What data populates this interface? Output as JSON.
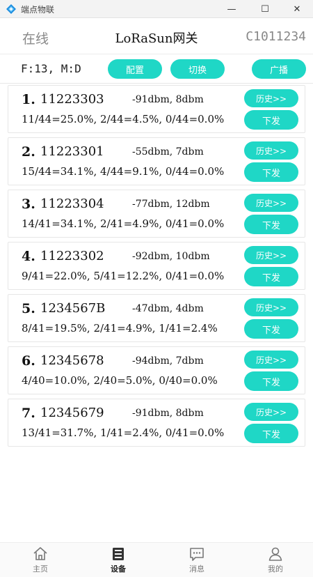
{
  "window": {
    "title": "端点物联",
    "minimize": "—",
    "maximize": "☐",
    "close": "✕"
  },
  "header": {
    "status": "在线",
    "title": "LoRaSun网关",
    "gateway_id": "C1011234"
  },
  "toolbar": {
    "freq_text": "F:13, M:D",
    "config_label": "配置",
    "switch_label": "切换",
    "broadcast_label": "广播"
  },
  "devices": [
    {
      "index": "1.",
      "id": "11223303",
      "signal": "-91dbm, 8dbm",
      "stats": "11/44=25.0%,  2/44=4.5%,  0/44=0.0%",
      "history_label": "历史>>",
      "send_label": "下发"
    },
    {
      "index": "2.",
      "id": "11223301",
      "signal": "-55dbm, 7dbm",
      "stats": "15/44=34.1%,  4/44=9.1%,  0/44=0.0%",
      "history_label": "历史>>",
      "send_label": "下发"
    },
    {
      "index": "3.",
      "id": "11223304",
      "signal": "-77dbm, 12dbm",
      "stats": "14/41=34.1%,  2/41=4.9%,  0/41=0.0%",
      "history_label": "历史>>",
      "send_label": "下发"
    },
    {
      "index": "4.",
      "id": "11223302",
      "signal": "-92dbm, 10dbm",
      "stats": "9/41=22.0%,  5/41=12.2%,  0/41=0.0%",
      "history_label": "历史>>",
      "send_label": "下发"
    },
    {
      "index": "5.",
      "id": "1234567B",
      "signal": "-47dbm, 4dbm",
      "stats": "8/41=19.5%,  2/41=4.9%,  1/41=2.4%",
      "history_label": "历史>>",
      "send_label": "下发"
    },
    {
      "index": "6.",
      "id": "12345678",
      "signal": "-94dbm, 7dbm",
      "stats": "4/40=10.0%,  2/40=5.0%,  0/40=0.0%",
      "history_label": "历史>>",
      "send_label": "下发"
    },
    {
      "index": "7.",
      "id": "12345679",
      "signal": "-91dbm, 8dbm",
      "stats": "13/41=31.7%,  1/41=2.4%,  0/41=0.0%",
      "history_label": "历史>>",
      "send_label": "下发"
    }
  ],
  "tabbar": {
    "home": {
      "label": "主页",
      "icon": "home-icon"
    },
    "devices": {
      "label": "设备",
      "icon": "devices-icon"
    },
    "messages": {
      "label": "消息",
      "icon": "message-icon"
    },
    "mine": {
      "label": "我的",
      "icon": "person-icon"
    },
    "active": "devices"
  },
  "colors": {
    "accent": "#1fd7c6",
    "muted_text": "#888888"
  }
}
